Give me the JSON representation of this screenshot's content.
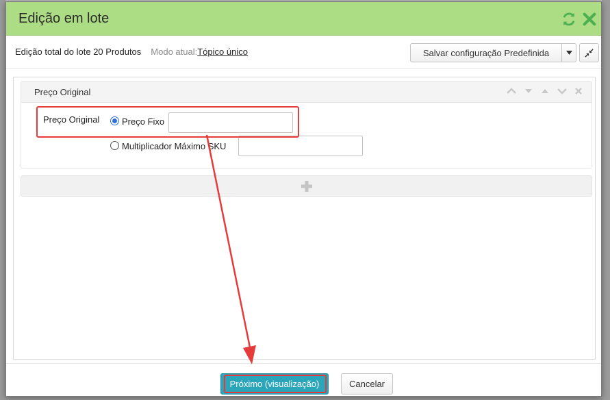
{
  "dialog": {
    "title": "Edição em lote"
  },
  "toolbar": {
    "info": "Edição total do lote 20 Produtos",
    "mode_label": "Modo atual:",
    "mode_value": "Tópico único",
    "save_label": "Salvar configuração Predefinida"
  },
  "panel": {
    "title": "Preço Original",
    "field_label": "Preço Original",
    "option_fixed": "Preço Fixo",
    "option_multiplier": "Multiplicador Máximo SKU",
    "fixed_value": "",
    "multiplier_value": ""
  },
  "footer": {
    "next_label": "Próximo (visualização)",
    "cancel_label": "Cancelar"
  },
  "colors": {
    "titlebar": "#acdc84",
    "accent": "#2aa5b9",
    "annotation": "#e53b3b"
  }
}
